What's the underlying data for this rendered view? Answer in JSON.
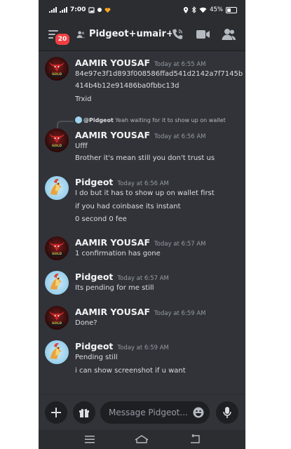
{
  "status_bar": {
    "time": "7:00",
    "battery": "45%"
  },
  "header": {
    "channel_name": "Pidgeot+umair+...",
    "notification_count": "20",
    "icons": [
      "menu-icon",
      "people-icon",
      "phone-call-icon",
      "video-camera-icon",
      "members-icon"
    ]
  },
  "messages": [
    {
      "author": "AAMIR YOUSAF",
      "avatar": "aamir",
      "timestamp": "Today at 6:55 AM",
      "lines": [
        "84e97e3f1d893f008586ffad541d2142a7f7145b",
        "414b4b12e91486ba0fbbc13d",
        "Trxid"
      ]
    },
    {
      "reply_to_author": "@Pidgeot",
      "reply_to_text": "Yeah waiting for it to show up on wallet",
      "author": "AAMIR YOUSAF",
      "avatar": "aamir",
      "timestamp": "Today at 6:56 AM",
      "lines": [
        "Ufff",
        "Brother it's mean still you don't trust us"
      ]
    },
    {
      "author": "Pidgeot",
      "avatar": "pidgeot",
      "timestamp": "Today at 6:56 AM",
      "lines": [
        "I do but it has to show up on wallet first",
        "if you had coinbase its instant",
        "0 second 0 fee"
      ]
    },
    {
      "author": "AAMIR YOUSAF",
      "avatar": "aamir",
      "timestamp": "Today at 6:57 AM",
      "lines": [
        "1 confirmation has gone"
      ]
    },
    {
      "author": "Pidgeot",
      "avatar": "pidgeot",
      "timestamp": "Today at 6:57 AM",
      "lines": [
        "Its pending for me still"
      ]
    },
    {
      "author": "AAMIR YOUSAF",
      "avatar": "aamir",
      "timestamp": "Today at 6:59 AM",
      "lines": [
        "Done?"
      ]
    },
    {
      "author": "Pidgeot",
      "avatar": "pidgeot",
      "timestamp": "Today at 6:59 AM",
      "lines": [
        "Pending still",
        "i can show screenshot if u want"
      ]
    }
  ],
  "avatar_badge_text": "GOLD",
  "composer": {
    "placeholder": "Message Pidgeot..."
  },
  "colors": {
    "background": "#313338",
    "header": "#2b2d31",
    "badge": "#f23f43",
    "text": "#dbdee1",
    "muted": "#949ba4"
  }
}
